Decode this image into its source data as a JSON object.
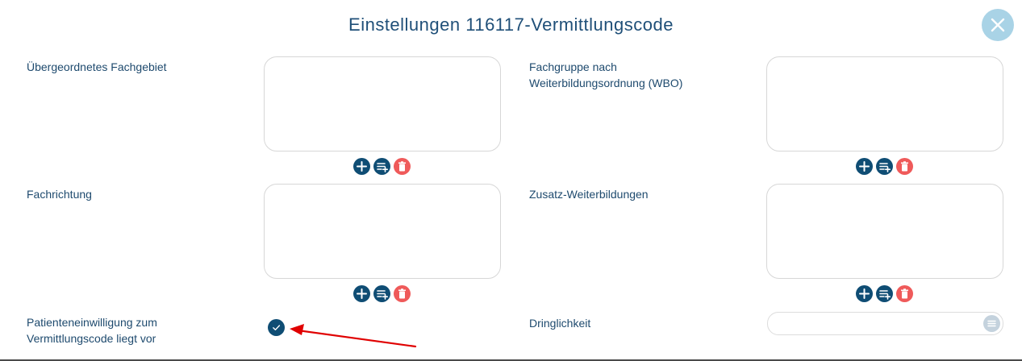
{
  "dialog": {
    "title": "Einstellungen 116117-Vermittlungscode",
    "close_icon": "close-icon"
  },
  "fields": {
    "uebergeordnetes_fachgebiet": {
      "label": "Übergeordnetes Fachgebiet"
    },
    "fachgruppe_wbo": {
      "label_line1": "Fachgruppe nach",
      "label_line2": "Weiterbildungsordnung (WBO)"
    },
    "fachrichtung": {
      "label": "Fachrichtung"
    },
    "zusatz_weiterbildungen": {
      "label": "Zusatz-Weiterbildungen"
    },
    "patienteneinwilligung": {
      "label_line1": "Patienteneinwilligung zum",
      "label_line2": "Vermittlungscode liegt vor",
      "checked": true
    },
    "dringlichkeit": {
      "label": "Dringlichkeit",
      "value": ""
    }
  },
  "icons": {
    "add": "plus-icon",
    "add_list": "playlist-add-icon",
    "delete": "trash-icon",
    "select": "list-icon",
    "check": "checkmark-icon"
  },
  "colors": {
    "primary": "#0f4d74",
    "delete": "#ef5a5a",
    "close_bg": "#a9d3e6",
    "annotation_arrow": "#e00000"
  }
}
